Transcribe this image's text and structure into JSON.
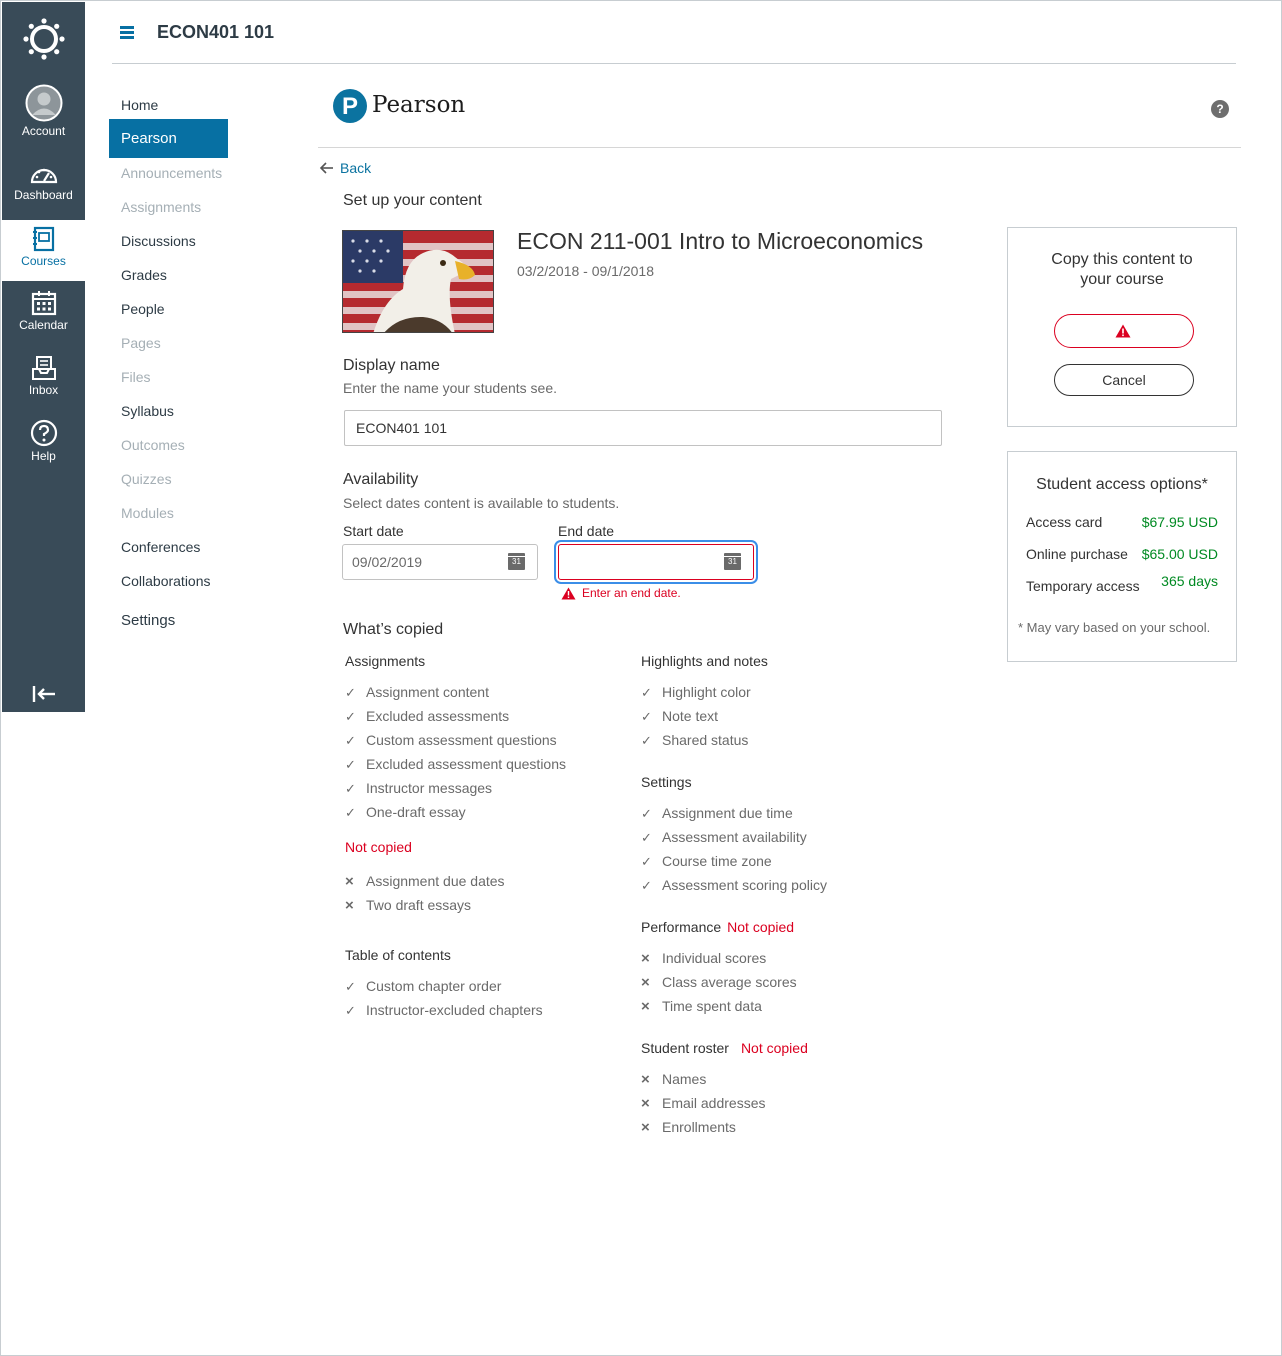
{
  "global_nav": {
    "account": "Account",
    "dashboard": "Dashboard",
    "courses": "Courses",
    "calendar": "Calendar",
    "inbox": "Inbox",
    "help": "Help"
  },
  "header": {
    "course_title": "ECON401 101"
  },
  "course_nav": [
    {
      "label": "Home",
      "state": "normal"
    },
    {
      "label": "Pearson",
      "state": "active"
    },
    {
      "label": "Announcements",
      "state": "disabled"
    },
    {
      "label": "Assignments",
      "state": "disabled"
    },
    {
      "label": "Discussions",
      "state": "normal"
    },
    {
      "label": "Grades",
      "state": "normal"
    },
    {
      "label": "People",
      "state": "normal"
    },
    {
      "label": "Pages",
      "state": "disabled"
    },
    {
      "label": "Files",
      "state": "disabled"
    },
    {
      "label": "Syllabus",
      "state": "normal"
    },
    {
      "label": "Outcomes",
      "state": "disabled"
    },
    {
      "label": "Quizzes",
      "state": "disabled"
    },
    {
      "label": "Modules",
      "state": "disabled"
    },
    {
      "label": "Conferences",
      "state": "normal"
    },
    {
      "label": "Collaborations",
      "state": "normal"
    },
    {
      "label": "Settings",
      "state": "normal"
    }
  ],
  "pearson": {
    "brand": "Pearson",
    "logo_letter": "P",
    "help_icon": "question-icon",
    "back": "Back",
    "setup_heading": "Set up your content",
    "product_title": "ECON 211-001 Intro to Microeconomics",
    "product_dates": "03/2/2018 - 09/1/2018",
    "display_name": {
      "heading": "Display name",
      "sub": "Enter the name your students see.",
      "value": "ECON401 101"
    },
    "availability": {
      "heading": "Availability",
      "sub": "Select dates content is available to students.",
      "start_label": "Start date",
      "start_value": "09/02/2019",
      "end_label": "End date",
      "end_value": "",
      "calendar_day": "31",
      "error": "Enter an end date."
    },
    "whats_copied": {
      "heading": "What’s copied",
      "assignments": {
        "title": "Assignments",
        "copied": [
          "Assignment content",
          "Excluded assessments",
          "Custom assessment questions",
          "Excluded assessment questions",
          "Instructor messages",
          "One-draft essay"
        ],
        "not_copied_label": "Not copied",
        "not_copied": [
          "Assignment due dates",
          "Two draft essays"
        ]
      },
      "toc": {
        "title": "Table of contents",
        "copied": [
          "Custom chapter order",
          "Instructor-excluded chapters"
        ]
      },
      "highlights": {
        "title": "Highlights and notes",
        "copied": [
          "Highlight color",
          "Note text",
          "Shared status"
        ]
      },
      "settings": {
        "title": "Settings",
        "copied": [
          "Assignment due time",
          "Assessment availability",
          "Course time zone",
          "Assessment scoring policy"
        ]
      },
      "performance": {
        "title": "Performance",
        "not_copied_label": "Not copied",
        "not_copied": [
          "Individual scores",
          "Class average scores",
          "Time spent data"
        ]
      },
      "roster": {
        "title": "Student roster",
        "not_copied_label": "Not copied",
        "not_copied": [
          "Names",
          "Email addresses",
          "Enrollments"
        ]
      }
    },
    "copy_panel": {
      "title_line1": "Copy this content to",
      "title_line2": "your course",
      "cancel": "Cancel"
    },
    "access_options": {
      "title": "Student access options*",
      "rows": [
        {
          "label": "Access card",
          "value": "$67.95 USD"
        },
        {
          "label": "Online purchase",
          "value": "$65.00 USD"
        },
        {
          "label": "Temporary access",
          "value": "365 days"
        }
      ],
      "note": "* May vary based on your school."
    }
  },
  "colors": {
    "nav_bg": "#394b58",
    "accent": "#0770a3",
    "error": "#db0020",
    "price": "#008a22"
  }
}
